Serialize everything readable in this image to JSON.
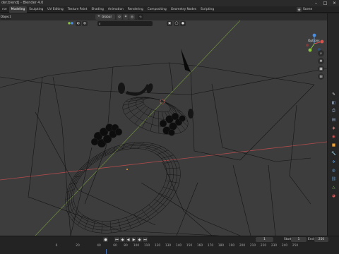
{
  "window": {
    "title": "der.blend] - Blender 4.0"
  },
  "workspace_tabs": [
    "rse",
    "Modeling",
    "Sculpting",
    "UV Editing",
    "Texture Paint",
    "Shading",
    "Animation",
    "Rendering",
    "Compositing",
    "Geometry Nodes",
    "Scripting"
  ],
  "active_tab": "Modeling",
  "scene": {
    "name": "Scene"
  },
  "viewport_header": {
    "mode_label": "Object",
    "transform_orientation": "Global",
    "options_label": "Options"
  },
  "timeline": {
    "current_frame": "1",
    "start_label": "Start",
    "start_value": "1",
    "end_label": "End",
    "end_value": "250",
    "ruler": [
      "0",
      "20",
      "40",
      "60",
      "80",
      "100",
      "110",
      "120",
      "130",
      "140",
      "150",
      "160",
      "170",
      "180",
      "190",
      "200",
      "210",
      "220",
      "230",
      "240",
      "250"
    ]
  },
  "colors": {
    "viewport_bg": "#3d3d3d",
    "x_axis": "#b14b4b",
    "y_axis": "#7ea640",
    "accent": "#4772b3",
    "gizmo_x": "#d9534f",
    "gizmo_y": "#8cc641",
    "gizmo_z": "#4a8fe0"
  },
  "icons": {
    "sidebar_tools": [
      "select-box-icon",
      "cursor-icon",
      "move-icon",
      "rotate-icon",
      "scale-icon",
      "transform-icon",
      "annotate-icon",
      "measure-icon",
      "add-cube-icon"
    ],
    "properties_tabs": [
      "tool-icon",
      "render-icon",
      "output-icon",
      "view-layer-icon",
      "scene-icon",
      "world-icon",
      "object-icon",
      "modifier-icon",
      "particles-icon",
      "physics-icon",
      "constraints-icon",
      "data-icon",
      "material-icon"
    ]
  }
}
